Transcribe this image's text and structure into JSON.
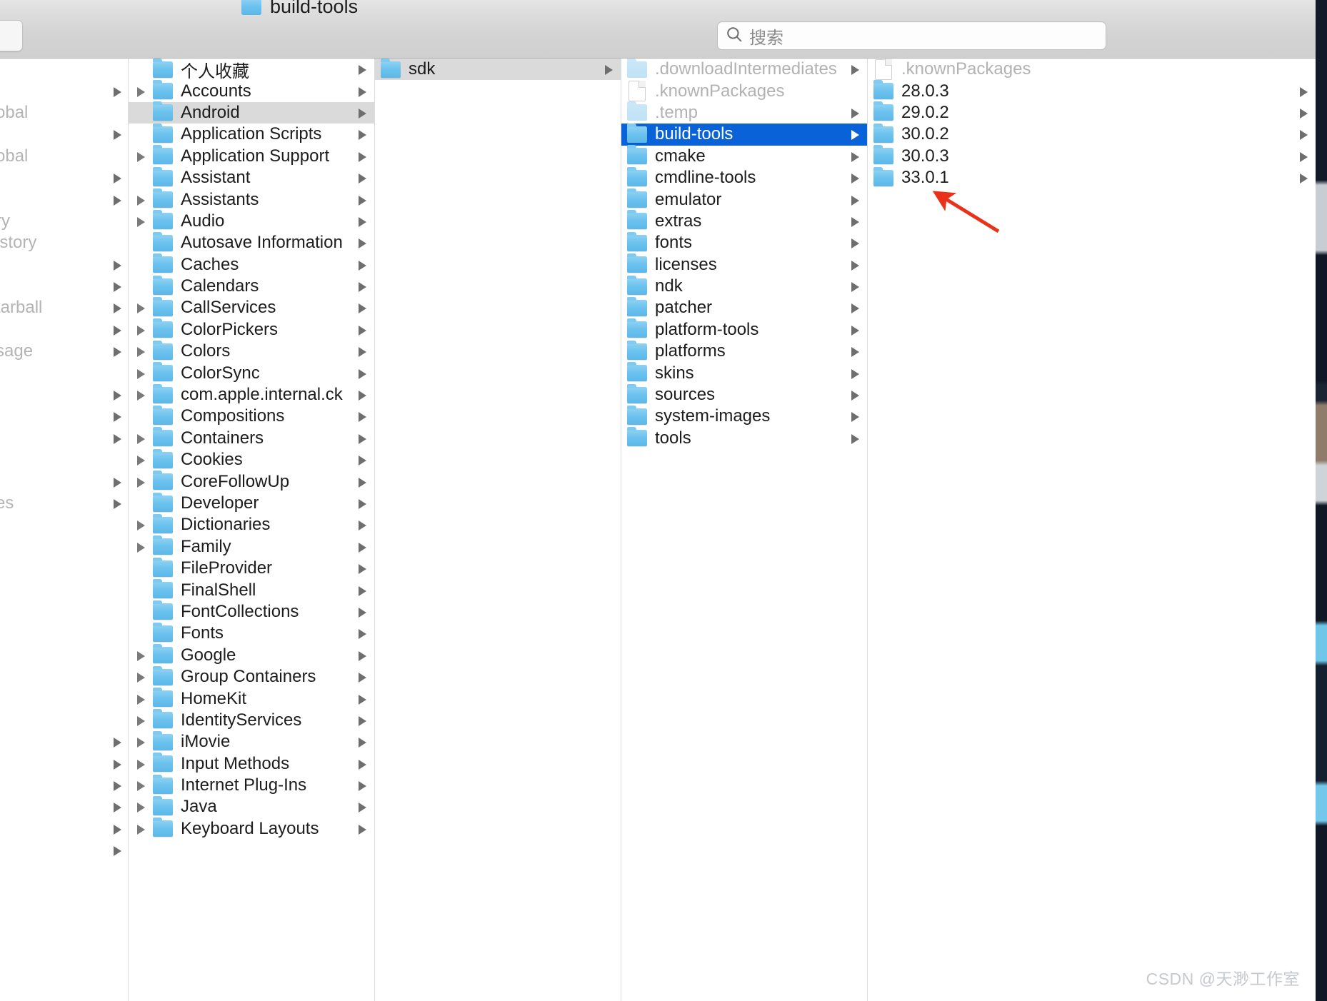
{
  "window": {
    "proxy_title": "build-tools",
    "proxy_icon": "folder-icon"
  },
  "search": {
    "placeholder": "搜索",
    "value": "",
    "icon": "search-icon"
  },
  "watermark": "CSDN @天渺工作室",
  "colors": {
    "selection_active": "#0a62d8",
    "selection_inactive": "#dadada",
    "folder_blue": "#6cc2ee",
    "annotation_red": "#e8321a",
    "toolbar_gray": "#d4d4d4"
  },
  "annotation": {
    "type": "arrow",
    "color": "#e8321a",
    "points_at": "33.0.1"
  },
  "columns": [
    {
      "name": "column-truncated",
      "truncated": true,
      "items": [
        {
          "label": "",
          "chevron": false
        },
        {
          "label": "",
          "chevron": true
        },
        {
          "label": "obal",
          "chevron": false
        },
        {
          "label": "",
          "chevron": true
        },
        {
          "label": "obal",
          "chevron": false
        },
        {
          "label": "",
          "chevron": true
        },
        {
          "label": "",
          "chevron": true
        },
        {
          "label": "ry",
          "chevron": false
        },
        {
          "label": "istory",
          "chevron": false
        },
        {
          "label": "",
          "chevron": true
        },
        {
          "label": "",
          "chevron": true
        },
        {
          "label": "tarball",
          "chevron": true
        },
        {
          "label": "",
          "chevron": true
        },
        {
          "label": "sage",
          "chevron": true
        },
        {
          "label": "",
          "chevron": false
        },
        {
          "label": "",
          "chevron": true
        },
        {
          "label": "",
          "chevron": true
        },
        {
          "label": "",
          "chevron": true
        },
        {
          "label": "",
          "chevron": false
        },
        {
          "label": "",
          "chevron": true
        },
        {
          "label": "es",
          "chevron": true
        },
        {
          "label": "",
          "chevron": false
        },
        {
          "label": "",
          "chevron": false
        },
        {
          "label": "",
          "chevron": false
        },
        {
          "label": "",
          "chevron": false
        },
        {
          "label": "",
          "chevron": false
        },
        {
          "label": "",
          "chevron": false
        },
        {
          "label": "",
          "chevron": false
        },
        {
          "label": "",
          "chevron": false
        },
        {
          "label": "",
          "chevron": false
        },
        {
          "label": "",
          "chevron": false
        },
        {
          "label": "",
          "chevron": true
        },
        {
          "label": "",
          "chevron": true
        },
        {
          "label": "",
          "chevron": true
        },
        {
          "label": "",
          "chevron": true
        },
        {
          "label": "",
          "chevron": true
        },
        {
          "label": "",
          "chevron": true
        }
      ]
    },
    {
      "name": "column-library",
      "items": [
        {
          "label": "个人收藏",
          "icon": "folder-icon",
          "chevron": true,
          "lead_chevron": false,
          "state": "normal"
        },
        {
          "label": "Accounts",
          "icon": "folder-icon",
          "chevron": true,
          "lead_chevron": true,
          "state": "normal"
        },
        {
          "label": "Android",
          "icon": "folder-icon",
          "chevron": true,
          "lead_chevron": false,
          "state": "selected-inactive"
        },
        {
          "label": "Application Scripts",
          "icon": "folder-icon",
          "chevron": true,
          "lead_chevron": false,
          "state": "normal"
        },
        {
          "label": "Application Support",
          "icon": "folder-icon",
          "chevron": true,
          "lead_chevron": true,
          "state": "normal"
        },
        {
          "label": "Assistant",
          "icon": "folder-icon",
          "chevron": true,
          "lead_chevron": false,
          "state": "normal"
        },
        {
          "label": "Assistants",
          "icon": "folder-icon",
          "chevron": true,
          "lead_chevron": true,
          "state": "normal"
        },
        {
          "label": "Audio",
          "icon": "folder-icon",
          "chevron": true,
          "lead_chevron": true,
          "state": "normal"
        },
        {
          "label": "Autosave Information",
          "icon": "folder-icon",
          "chevron": true,
          "lead_chevron": false,
          "state": "normal"
        },
        {
          "label": "Caches",
          "icon": "folder-icon",
          "chevron": true,
          "lead_chevron": false,
          "state": "normal"
        },
        {
          "label": "Calendars",
          "icon": "folder-icon",
          "chevron": true,
          "lead_chevron": false,
          "state": "normal"
        },
        {
          "label": "CallServices",
          "icon": "folder-icon",
          "chevron": true,
          "lead_chevron": true,
          "state": "normal"
        },
        {
          "label": "ColorPickers",
          "icon": "folder-icon",
          "chevron": true,
          "lead_chevron": true,
          "state": "normal"
        },
        {
          "label": "Colors",
          "icon": "folder-icon",
          "chevron": true,
          "lead_chevron": true,
          "state": "normal"
        },
        {
          "label": "ColorSync",
          "icon": "folder-icon",
          "chevron": true,
          "lead_chevron": true,
          "state": "normal"
        },
        {
          "label": "com.apple.internal.ck",
          "icon": "folder-icon",
          "chevron": true,
          "lead_chevron": true,
          "state": "normal"
        },
        {
          "label": "Compositions",
          "icon": "folder-icon",
          "chevron": true,
          "lead_chevron": false,
          "state": "normal"
        },
        {
          "label": "Containers",
          "icon": "folder-icon",
          "chevron": true,
          "lead_chevron": true,
          "state": "normal"
        },
        {
          "label": "Cookies",
          "icon": "folder-icon",
          "chevron": true,
          "lead_chevron": true,
          "state": "normal"
        },
        {
          "label": "CoreFollowUp",
          "icon": "folder-icon",
          "chevron": true,
          "lead_chevron": true,
          "state": "normal"
        },
        {
          "label": "Developer",
          "icon": "folder-icon",
          "chevron": true,
          "lead_chevron": false,
          "state": "normal"
        },
        {
          "label": "Dictionaries",
          "icon": "folder-icon",
          "chevron": true,
          "lead_chevron": true,
          "state": "normal"
        },
        {
          "label": "Family",
          "icon": "folder-icon",
          "chevron": true,
          "lead_chevron": true,
          "state": "normal"
        },
        {
          "label": "FileProvider",
          "icon": "folder-icon",
          "chevron": true,
          "lead_chevron": false,
          "state": "normal"
        },
        {
          "label": "FinalShell",
          "icon": "folder-icon",
          "chevron": true,
          "lead_chevron": false,
          "state": "normal"
        },
        {
          "label": "FontCollections",
          "icon": "folder-icon",
          "chevron": true,
          "lead_chevron": false,
          "state": "normal"
        },
        {
          "label": "Fonts",
          "icon": "folder-icon",
          "chevron": true,
          "lead_chevron": false,
          "state": "normal"
        },
        {
          "label": "Google",
          "icon": "folder-icon",
          "chevron": true,
          "lead_chevron": true,
          "state": "normal"
        },
        {
          "label": "Group Containers",
          "icon": "folder-icon",
          "chevron": true,
          "lead_chevron": true,
          "state": "normal"
        },
        {
          "label": "HomeKit",
          "icon": "folder-icon",
          "chevron": true,
          "lead_chevron": true,
          "state": "normal"
        },
        {
          "label": "IdentityServices",
          "icon": "folder-icon",
          "chevron": true,
          "lead_chevron": true,
          "state": "normal"
        },
        {
          "label": "iMovie",
          "icon": "folder-icon",
          "chevron": true,
          "lead_chevron": true,
          "state": "normal"
        },
        {
          "label": "Input Methods",
          "icon": "folder-icon",
          "chevron": true,
          "lead_chevron": true,
          "state": "normal"
        },
        {
          "label": "Internet Plug-Ins",
          "icon": "folder-icon",
          "chevron": true,
          "lead_chevron": true,
          "state": "normal"
        },
        {
          "label": "Java",
          "icon": "folder-icon",
          "chevron": true,
          "lead_chevron": true,
          "state": "normal"
        },
        {
          "label": "Keyboard Layouts",
          "icon": "folder-icon",
          "chevron": true,
          "lead_chevron": true,
          "state": "normal"
        }
      ]
    },
    {
      "name": "column-android",
      "items": [
        {
          "label": "sdk",
          "icon": "folder-icon",
          "chevron": true,
          "state": "selected-inactive"
        }
      ]
    },
    {
      "name": "column-sdk",
      "items": [
        {
          "label": ".downloadIntermediates",
          "icon": "folder-icon",
          "chevron": true,
          "state": "dim"
        },
        {
          "label": ".knownPackages",
          "icon": "document-icon",
          "chevron": false,
          "state": "dim"
        },
        {
          "label": ".temp",
          "icon": "folder-icon",
          "chevron": true,
          "state": "dim"
        },
        {
          "label": "build-tools",
          "icon": "folder-icon",
          "chevron": true,
          "state": "selected-active"
        },
        {
          "label": "cmake",
          "icon": "folder-icon",
          "chevron": true,
          "state": "normal"
        },
        {
          "label": "cmdline-tools",
          "icon": "folder-icon",
          "chevron": true,
          "state": "normal"
        },
        {
          "label": "emulator",
          "icon": "folder-icon",
          "chevron": true,
          "state": "normal"
        },
        {
          "label": "extras",
          "icon": "folder-icon",
          "chevron": true,
          "state": "normal"
        },
        {
          "label": "fonts",
          "icon": "folder-icon",
          "chevron": true,
          "state": "normal"
        },
        {
          "label": "licenses",
          "icon": "folder-icon",
          "chevron": true,
          "state": "normal"
        },
        {
          "label": "ndk",
          "icon": "folder-icon",
          "chevron": true,
          "state": "normal"
        },
        {
          "label": "patcher",
          "icon": "folder-icon",
          "chevron": true,
          "state": "normal"
        },
        {
          "label": "platform-tools",
          "icon": "folder-icon",
          "chevron": true,
          "state": "normal"
        },
        {
          "label": "platforms",
          "icon": "folder-icon",
          "chevron": true,
          "state": "normal"
        },
        {
          "label": "skins",
          "icon": "folder-icon",
          "chevron": true,
          "state": "normal"
        },
        {
          "label": "sources",
          "icon": "folder-icon",
          "chevron": true,
          "state": "normal"
        },
        {
          "label": "system-images",
          "icon": "folder-icon",
          "chevron": true,
          "state": "normal"
        },
        {
          "label": "tools",
          "icon": "folder-icon",
          "chevron": true,
          "state": "normal"
        }
      ]
    },
    {
      "name": "column-build-tools",
      "items": [
        {
          "label": ".knownPackages",
          "icon": "document-icon",
          "chevron": false,
          "state": "dim"
        },
        {
          "label": "28.0.3",
          "icon": "folder-icon",
          "chevron": true,
          "state": "normal"
        },
        {
          "label": "29.0.2",
          "icon": "folder-icon",
          "chevron": true,
          "state": "normal"
        },
        {
          "label": "30.0.2",
          "icon": "folder-icon",
          "chevron": true,
          "state": "normal"
        },
        {
          "label": "30.0.3",
          "icon": "folder-icon",
          "chevron": true,
          "state": "normal"
        },
        {
          "label": "33.0.1",
          "icon": "folder-icon",
          "chevron": true,
          "state": "normal"
        }
      ]
    }
  ]
}
